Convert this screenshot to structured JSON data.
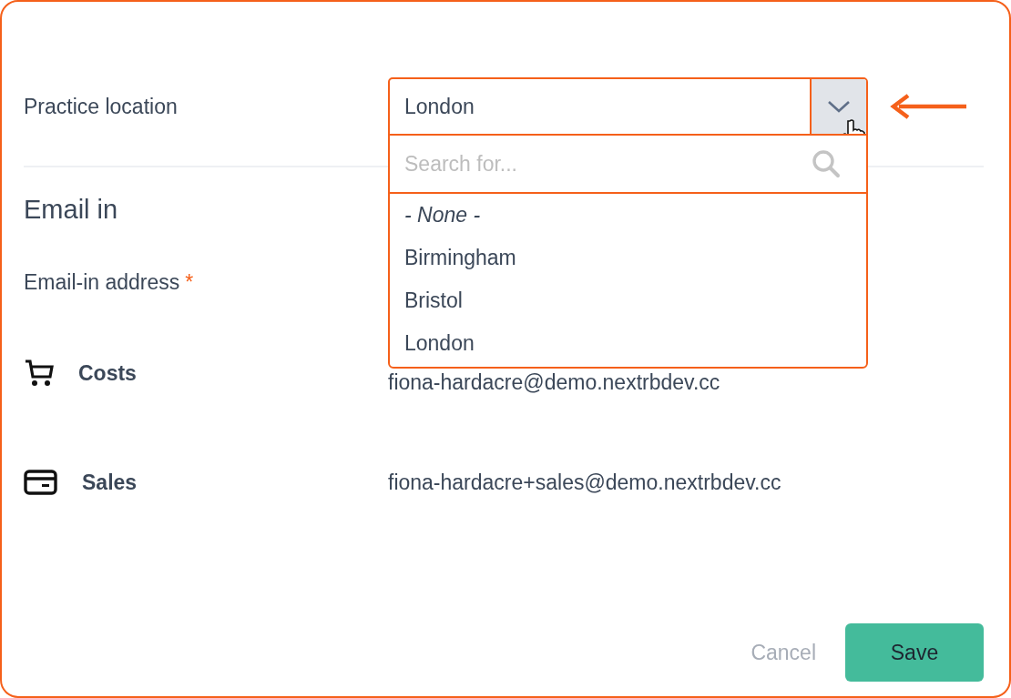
{
  "practice_location": {
    "label": "Practice location",
    "value": "London",
    "expanded": true,
    "search": {
      "placeholder": "Search for..."
    },
    "options": [
      {
        "label": "- None -",
        "kind": "none"
      },
      {
        "label": "Birmingham",
        "kind": "place"
      },
      {
        "label": "Bristol",
        "kind": "place"
      },
      {
        "label": "London",
        "kind": "place"
      }
    ]
  },
  "email_in": {
    "heading": "Email in",
    "address_label": "Email-in address",
    "required_mark": "*",
    "rows": [
      {
        "kind": "costs",
        "name": "Costs",
        "address": "fiona-hardacre@demo.nextrbdev.cc"
      },
      {
        "kind": "sales",
        "name": "Sales",
        "address": "fiona-hardacre+sales@demo.nextrbdev.cc"
      }
    ]
  },
  "buttons": {
    "cancel": "Cancel",
    "save": "Save"
  }
}
